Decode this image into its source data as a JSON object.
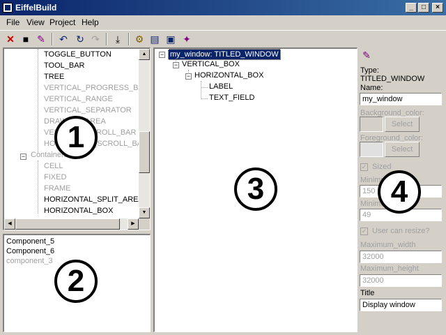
{
  "window": {
    "title": "EiffelBuild",
    "minimize": "_",
    "maximize": "□",
    "close": "×"
  },
  "menu": [
    "File",
    "View",
    "Project",
    "Help"
  ],
  "toolbar": {
    "icons": [
      "delete-icon",
      "save-icon",
      "properties-icon",
      "undo-icon",
      "history-icon",
      "redo-icon",
      "import-icon",
      "component-selector-icon",
      "layout-constructor-icon",
      "display-window-icon",
      "builder-window-icon"
    ],
    "glyphs": {
      "delete": "✕",
      "save": "■",
      "undo": "↶",
      "history": "↻",
      "redo": "↷",
      "import": "⤓",
      "gear": "⚙",
      "window": "▤",
      "window2": "▣",
      "build": "✦",
      "wand": "✎"
    }
  },
  "type_selector": {
    "items": [
      {
        "label": "TOGGLE_BUTTON",
        "grey": false
      },
      {
        "label": "TOOL_BAR",
        "grey": false
      },
      {
        "label": "TREE",
        "grey": false
      },
      {
        "label": "VERTICAL_PROGRESS_BAR",
        "grey": true
      },
      {
        "label": "VERTICAL_RANGE",
        "grey": true
      },
      {
        "label": "VERTICAL_SEPARATOR",
        "grey": true
      },
      {
        "label": "DRAWING_AREA",
        "grey": true
      },
      {
        "label": "VERTICAL_SCROLL_BAR",
        "grey": true
      },
      {
        "label": "HORIZONTAL_SCROLL_BAR",
        "grey": true
      }
    ],
    "group_label": "Containers",
    "container_items": [
      {
        "label": "CELL",
        "grey": true
      },
      {
        "label": "FIXED",
        "grey": true
      },
      {
        "label": "FRAME",
        "grey": true
      },
      {
        "label": "HORIZONTAL_SPLIT_AREA",
        "grey": false
      },
      {
        "label": "HORIZONTAL_BOX",
        "grey": false
      }
    ],
    "group_expander": "−"
  },
  "component_selector": {
    "items": [
      {
        "label": "Component_5",
        "grey": false
      },
      {
        "label": "Component_6",
        "grey": false
      },
      {
        "label": "component_3",
        "grey": true
      }
    ]
  },
  "layout_tree": {
    "root": "my_window: TITLED_WINDOW",
    "vertical_box": "VERTICAL_BOX",
    "horizontal_box": "HORIZONTAL_BOX",
    "label": "LABEL",
    "text_field": "TEXT_FIELD",
    "expander": "−"
  },
  "properties": {
    "type_label": "Type:",
    "type_value": "TITLED_WINDOW",
    "name_label": "Name:",
    "name_value": "my_window",
    "background_label": "Background_color:",
    "foreground_label": "Foreground_color:",
    "select_label": "Select",
    "sized_label": "Sized",
    "min_width_label": "Minimum_width",
    "min_width_value": "150",
    "min_height_label": "Minimum_height",
    "min_height_value": "49",
    "resize_label": "User can resize?",
    "max_width_label": "Maximum_width",
    "max_width_value": "32000",
    "max_height_label": "Maximum_height",
    "max_height_value": "32000",
    "title_label": "Title",
    "title_value": "Display window",
    "check_mark": "✓"
  },
  "callouts": [
    "1",
    "2",
    "3",
    "4"
  ],
  "colors": {
    "selection": "#0a246a",
    "disabled": "#a0a0a0",
    "delete_red": "#cc0000"
  }
}
